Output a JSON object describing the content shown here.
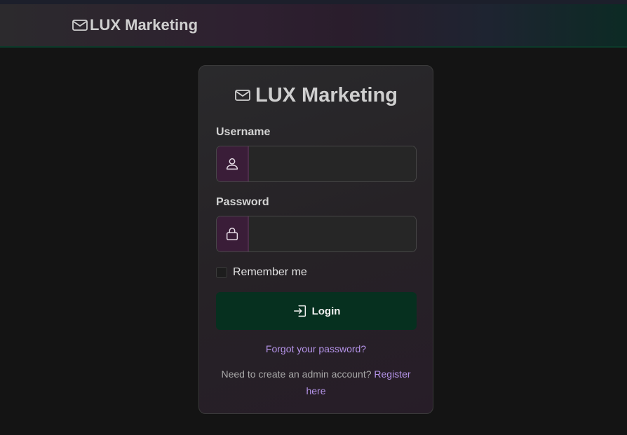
{
  "navbar": {
    "brand_icon": "envelope-icon",
    "brand_text": "LUX Marketing"
  },
  "card": {
    "title_icon": "envelope-icon",
    "title": "LUX Marketing",
    "username": {
      "label": "Username",
      "icon": "person-icon",
      "value": ""
    },
    "password": {
      "label": "Password",
      "icon": "lock-icon",
      "value": ""
    },
    "remember": {
      "label": "Remember me",
      "checked": false
    },
    "login": {
      "icon": "box-arrow-in-right-icon",
      "label": "Login"
    },
    "forgot_link": "Forgot your password?",
    "register": {
      "prompt": "Need to create an admin account?",
      "link": "Register here"
    }
  },
  "colors": {
    "page_background": "#141414",
    "addon_background": "#3a1d38",
    "login_button": "#06301f",
    "link": "#b493e8"
  }
}
